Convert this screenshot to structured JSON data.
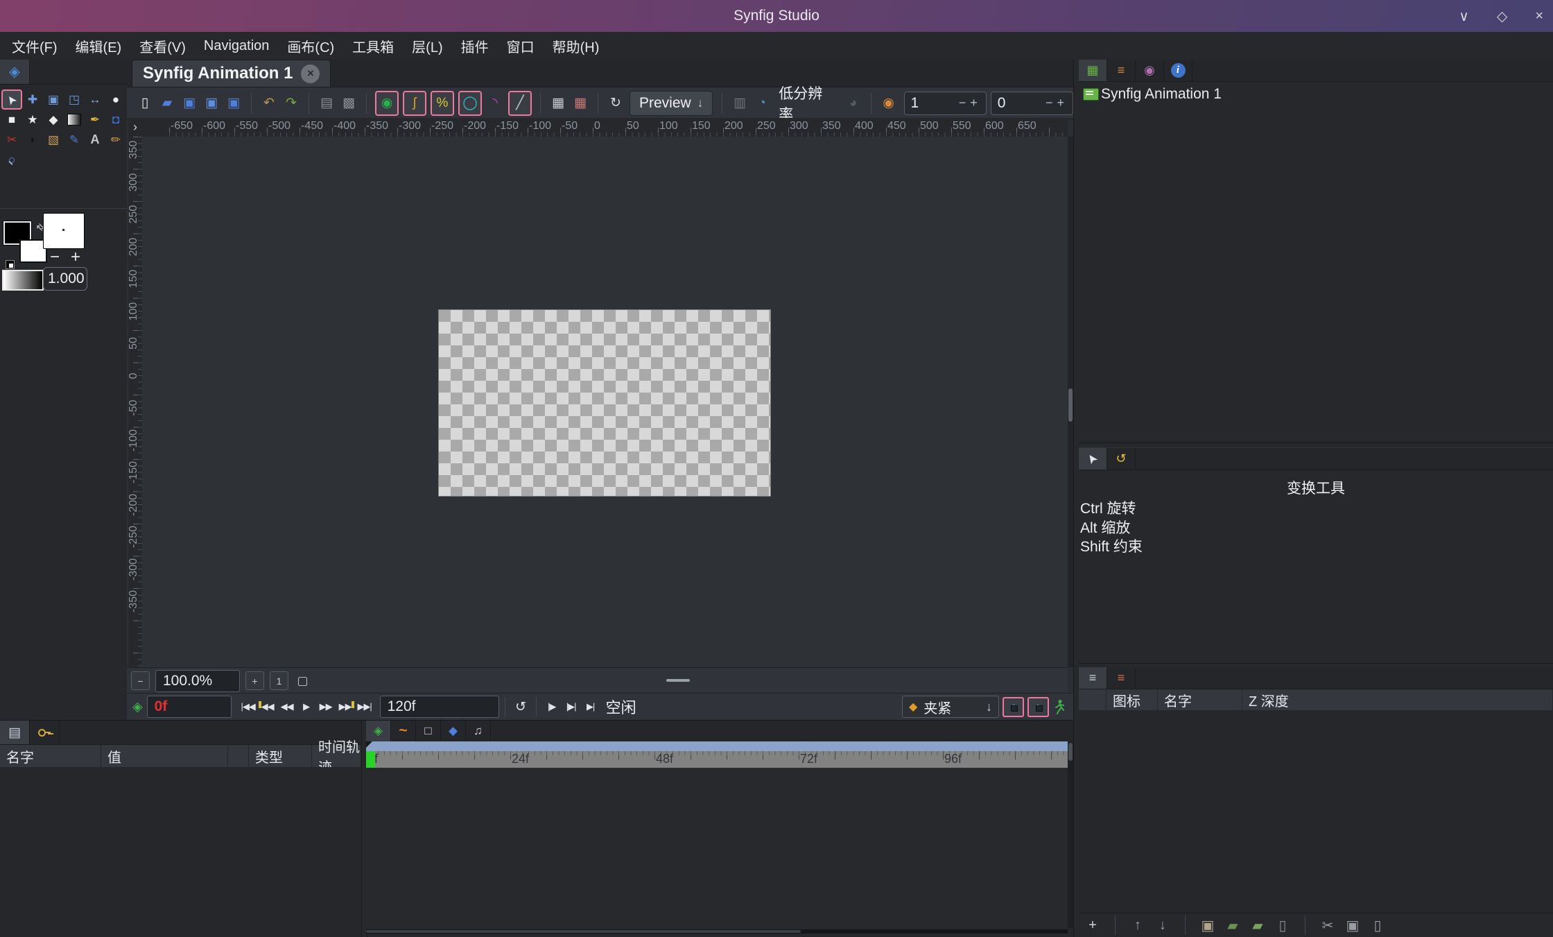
{
  "window": {
    "title": "Synfig Studio",
    "controls": [
      {
        "name": "minimize-button",
        "glyph": "∨"
      },
      {
        "name": "maximize-button",
        "glyph": "◇"
      },
      {
        "name": "close-button",
        "glyph": "×"
      }
    ]
  },
  "menubar": {
    "items": [
      {
        "name": "menu-file",
        "label": "文件(F)"
      },
      {
        "name": "menu-edit",
        "label": "编辑(E)"
      },
      {
        "name": "menu-view",
        "label": "查看(V)"
      },
      {
        "name": "menu-navigation",
        "label": "Navigation"
      },
      {
        "name": "menu-canvas",
        "label": "画布(C)"
      },
      {
        "name": "menu-toolbox",
        "label": "工具箱"
      },
      {
        "name": "menu-layer",
        "label": "层(L)"
      },
      {
        "name": "menu-plugins",
        "label": "插件"
      },
      {
        "name": "menu-window",
        "label": "窗口"
      },
      {
        "name": "menu-help",
        "label": "帮助(H)"
      }
    ]
  },
  "toolbox": {
    "tab_icon": {
      "name": "synfig-logo-icon",
      "glyph": "◈",
      "color": "#4a8ad8"
    },
    "tools": [
      {
        "name": "transform-tool",
        "glyph": "➤",
        "color": "#e9e9ed",
        "cls": "cursor-rot",
        "selected": true
      },
      {
        "name": "smooth-move-tool",
        "glyph": "✚",
        "color": "#6f9bdc"
      },
      {
        "name": "mirror-tool",
        "glyph": "▣",
        "color": "#6f9bdc"
      },
      {
        "name": "scale-tool",
        "glyph": "◳",
        "color": "#6f9bdc"
      },
      {
        "name": "width-tool",
        "glyph": "↔",
        "color": "#8fb4e4"
      },
      {
        "name": "circle-tool",
        "glyph": "●",
        "color": "#ececec"
      },
      {
        "name": "rectangle-tool",
        "glyph": "■",
        "color": "#ececec"
      },
      {
        "name": "star-tool",
        "glyph": "★",
        "color": "#ececec"
      },
      {
        "name": "polygon-tool",
        "glyph": "◆",
        "color": "#ececec"
      },
      {
        "name": "gradient-tool",
        "glyph": "",
        "cls": "gradient-swatch"
      },
      {
        "name": "spline-tool",
        "glyph": "✒",
        "color": "#d8b43c"
      },
      {
        "name": "fill-tool",
        "glyph": "◘",
        "color": "#3f6fd0"
      },
      {
        "name": "cutout-tool",
        "glyph": "✂",
        "color": "#d03030"
      },
      {
        "name": "draw-tool",
        "glyph": "◗",
        "color": "#141414"
      },
      {
        "name": "brush-tool",
        "glyph": "▧",
        "color": "#c9a05a"
      },
      {
        "name": "sketch-tool",
        "glyph": "✎",
        "color": "#4a7fd0"
      },
      {
        "name": "text-tool",
        "glyph": "A",
        "color": "#c8c8cc",
        "cls": "bold"
      },
      {
        "name": "pencil-tool",
        "glyph": "✏",
        "color": "#d89c50"
      },
      {
        "name": "zoom-tool",
        "glyph": "○",
        "color": "#6f9bdc",
        "cls": "mag"
      }
    ],
    "opacity_value": "1.000"
  },
  "canvas_window": {
    "tab": {
      "title": "Synfig Animation 1",
      "close_glyph": "×"
    },
    "toolbar_buttons": [
      {
        "name": "new-document-button",
        "glyph": "▯",
        "color": "#e9e9e9"
      },
      {
        "name": "open-document-button",
        "glyph": "▰",
        "color": "#4f7fd9"
      },
      {
        "name": "save-button",
        "glyph": "▣",
        "color": "#4f7fd9"
      },
      {
        "name": "save-as-button",
        "glyph": "▣",
        "color": "#5f8fe0"
      },
      {
        "name": "save-all-button",
        "glyph": "▣",
        "color": "#4f7fd9"
      },
      {
        "sep": true
      },
      {
        "name": "undo-button",
        "glyph": "↶",
        "color": "#b09a50"
      },
      {
        "name": "redo-button",
        "glyph": "↷",
        "color": "#7aa843"
      },
      {
        "sep": true
      },
      {
        "name": "render-button",
        "glyph": "▤",
        "color": "#8a8d93"
      },
      {
        "name": "preview-render-button",
        "glyph": "▩",
        "color": "#8a8d93"
      },
      {
        "sep": true
      },
      {
        "name": "past-keyframe-toggle",
        "glyph": "◉",
        "color": "#2ab24a",
        "cls": "pink"
      },
      {
        "name": "keyframe-curve-toggle",
        "glyph": "ʃ",
        "color": "#e0a020",
        "cls": "pink"
      },
      {
        "name": "keyframe-line-toggle",
        "glyph": "%",
        "color": "#d8cc30",
        "cls": "pink"
      },
      {
        "name": "future-keyframe-toggle",
        "glyph": "◯",
        "color": "#2ac8d8",
        "cls": "pink"
      },
      {
        "name": "keyframe-draw-toggle",
        "glyph": "◝",
        "color": "#d040c0"
      },
      {
        "name": "keyframe-angle-toggle",
        "glyph": "╱",
        "color": "#c0c8d4",
        "cls": "pink"
      },
      {
        "sep": true
      },
      {
        "name": "grid-toggle",
        "glyph": "▦",
        "color": "#c8ccd2"
      },
      {
        "name": "grid-snap-toggle",
        "glyph": "▦",
        "color": "#c87878"
      },
      {
        "sep": true
      },
      {
        "name": "refresh-button",
        "glyph": "↻",
        "color": "#d8dade"
      }
    ],
    "preview_dropdown": {
      "label": "Preview",
      "arrow": "↓"
    },
    "toolbar2": {
      "camera_icon": "▥",
      "quality_down_icon": "◔",
      "lowres_label": "低分辨率",
      "quality_up_icon": "◕",
      "onion_icon": "◉",
      "past_onion_value": "1",
      "future_onion_value": "0",
      "spin_minus": "−",
      "spin_plus": "+"
    },
    "ruler_corner_glyph": "›",
    "ruler_top_labels": [
      "-650",
      "-600",
      "-550",
      "-500",
      "-450",
      "-400",
      "-350",
      "-300",
      "-250",
      "-200",
      "-150",
      "-100",
      "-50",
      "0",
      "50",
      "100",
      "150",
      "200",
      "250",
      "300",
      "350",
      "400",
      "450",
      "500",
      "550",
      "600",
      "650"
    ],
    "ruler_left_labels": [
      "350",
      "300",
      "250",
      "200",
      "150",
      "100",
      "50",
      "0",
      "-50",
      "-100",
      "-150",
      "-200",
      "-250",
      "-300",
      "-350"
    ],
    "statusbar": {
      "toggle_glyph": "−",
      "zoom_value": "100.0%",
      "zoom_in_glyph": "+",
      "actual_size_glyph": "1",
      "fit_glyph": "▢",
      "shield_glyph": "◈",
      "current_time": "0f",
      "end_time": "120f",
      "loop_glyph": "↺",
      "status_text": "空闲",
      "playback_buttons": [
        {
          "name": "seek-begin-button",
          "glyph": "|◀◀"
        },
        {
          "name": "seek-prev-keyframe-button",
          "glyph": "◀◀",
          "cls": "kf-l"
        },
        {
          "name": "prev-frame-button",
          "glyph": "◀◀"
        },
        {
          "name": "play-button",
          "glyph": "▶"
        },
        {
          "name": "next-frame-button",
          "glyph": "▶▶"
        },
        {
          "name": "seek-next-keyframe-button",
          "glyph": "▶▶",
          "cls": "kf-r"
        },
        {
          "name": "seek-end-button",
          "glyph": "▶▶|"
        }
      ],
      "bounds_buttons": [
        {
          "name": "play-bounds-lower-button",
          "glyph": "|▶"
        },
        {
          "name": "play-bounds-button",
          "glyph": "|▶|"
        },
        {
          "name": "play-bounds-upper-button",
          "glyph": "▶|"
        }
      ],
      "interpolation": {
        "diamond_glyph": "◆",
        "label": "夹紧",
        "arrow_glyph": "↓"
      },
      "lock_buttons": [
        {
          "name": "past-keyframe-lock-button",
          "glyph": "◖"
        },
        {
          "name": "future-keyframe-lock-button",
          "glyph": "◗"
        }
      ]
    }
  },
  "right_panel": {
    "top_tabs": [
      {
        "name": "tab-canvases",
        "glyph": "▦",
        "color": "#67b346",
        "selected": true
      },
      {
        "name": "tab-keyframes",
        "glyph": "≡",
        "color": "#d88a3a"
      },
      {
        "name": "tab-navigator",
        "glyph": "◉",
        "color": "#b06fb0"
      },
      {
        "name": "tab-info",
        "glyph": "i",
        "cls": "circle-blue"
      }
    ],
    "canvases_tree_item": "Synfig Animation 1",
    "mid_tabs": [
      {
        "name": "tab-transform-options",
        "glyph": "➤",
        "color": "#e9e9ed",
        "cls": "cursor-rot",
        "selected": true
      },
      {
        "name": "tab-smooth-move-options",
        "glyph": "↺",
        "color": "#e0c040"
      }
    ],
    "tool_options": {
      "title": "变换工具",
      "lines": [
        {
          "label": "Ctrl 旋转"
        },
        {
          "label": "Alt 缩放"
        },
        {
          "label": "Shift 约束"
        }
      ]
    },
    "bottom_tabs": [
      {
        "name": "tab-layers",
        "glyph": "≡",
        "color": "#c9d4e0",
        "selected": true
      },
      {
        "name": "tab-layer-groups",
        "glyph": "≡",
        "color": "#d07050"
      }
    ],
    "layers_columns": [
      {
        "label": "图标",
        "cls": "lh-icon"
      },
      {
        "label": "名字",
        "cls": "lh-name"
      },
      {
        "label": "Z 深度",
        "cls": "lh-z"
      }
    ],
    "layer_ops": [
      {
        "name": "add-layer-button",
        "glyph": "+",
        "color": "#d0d3d8"
      },
      {
        "sep": true
      },
      {
        "name": "raise-layer-button",
        "glyph": "↑",
        "color": "#9a9da3"
      },
      {
        "name": "lower-layer-button",
        "glyph": "↓",
        "color": "#9a9da3"
      },
      {
        "sep": true
      },
      {
        "name": "duplicate-layer-button",
        "glyph": "▣",
        "color": "#b0a58a"
      },
      {
        "name": "group-layer-button",
        "glyph": "▰",
        "color": "#6a9152"
      },
      {
        "name": "ungroup-layer-button",
        "glyph": "▰",
        "color": "#7aa162"
      },
      {
        "name": "delete-layer-button",
        "glyph": "▯",
        "color": "#8a8d93"
      },
      {
        "sep": true
      },
      {
        "name": "cut-button",
        "glyph": "✂",
        "color": "#9a9da3"
      },
      {
        "name": "copy-button",
        "glyph": "▣",
        "color": "#9a9da3"
      },
      {
        "name": "paste-button",
        "glyph": "▯",
        "color": "#9a9da3"
      }
    ]
  },
  "bottom_panel": {
    "left_tabs": [
      {
        "name": "tab-params",
        "glyph": "▤",
        "color": "#c9d4e0",
        "selected": true
      },
      {
        "name": "tab-keyframe-list",
        "glyph": "",
        "cls": "key-shape"
      }
    ],
    "params_columns": [
      {
        "label": "名字",
        "cls": "c-name"
      },
      {
        "label": "值",
        "cls": "c-value"
      },
      {
        "label": "",
        "cls": "c-sp"
      },
      {
        "label": "类型",
        "cls": "c-type"
      },
      {
        "label": "时间轨迹",
        "cls": "c-track"
      }
    ],
    "timetrack_tabs": [
      {
        "name": "tab-timetrack-params",
        "glyph": "◈",
        "color": "#3fae49",
        "selected": true
      },
      {
        "name": "tab-curves",
        "glyph": "~",
        "color": "#e0872a",
        "cls": "bold-big"
      },
      {
        "name": "tab-children",
        "glyph": "□",
        "color": "#d5d8dc"
      },
      {
        "name": "tab-meta-data",
        "glyph": "◆",
        "color": "#4f7fd9"
      },
      {
        "name": "tab-sound",
        "glyph": "♫",
        "color": "#c9ccd2"
      }
    ],
    "timetrack_tick_labels": [
      "0f",
      "24f",
      "48f",
      "72f",
      "96f"
    ]
  }
}
